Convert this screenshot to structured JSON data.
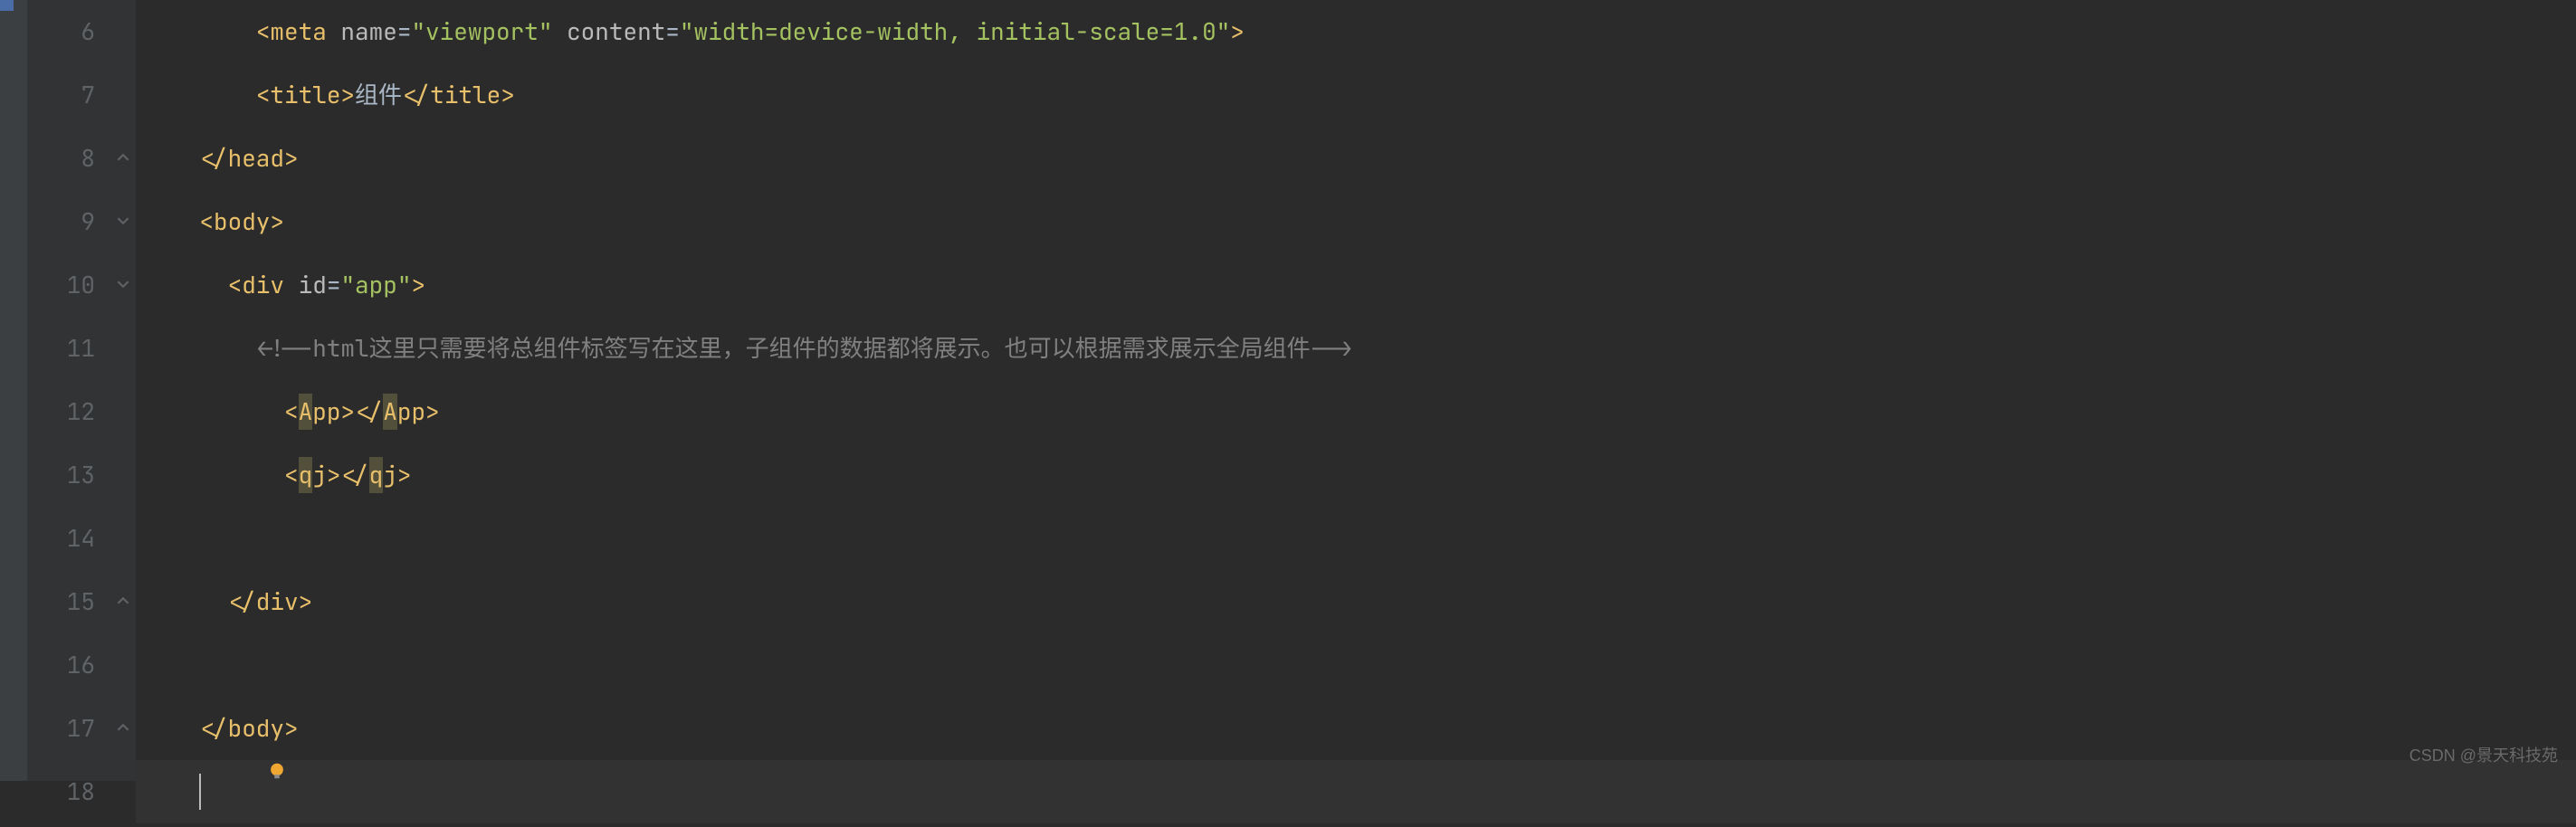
{
  "gutter": {
    "start": 6,
    "end": 18
  },
  "foldMarkers": [
    {
      "line": 8,
      "type": "up"
    },
    {
      "line": 9,
      "type": "down"
    },
    {
      "line": 10,
      "type": "down"
    },
    {
      "line": 15,
      "type": "up"
    },
    {
      "line": 17,
      "type": "up"
    }
  ],
  "bulb": {
    "line": 17
  },
  "code": {
    "line6": {
      "indent": "        ",
      "tagOpen": "<meta ",
      "attr1": "name",
      "eq1": "=",
      "val1": "\"viewport\"",
      "sp1": " ",
      "attr2": "content",
      "eq2": "=",
      "val2": "\"width=device-width, initial-scale=1.0\"",
      "tagClose": ">"
    },
    "line7": {
      "indent": "        ",
      "open": "<title>",
      "text": "组件",
      "close": "</title>"
    },
    "line8": {
      "indent": "    ",
      "close": "</head>"
    },
    "line9": {
      "indent": "    ",
      "open": "<body>"
    },
    "line10": {
      "indent": "      ",
      "openStart": "<div ",
      "attr": "id",
      "eq": "=",
      "val": "\"app\"",
      "openEnd": ">"
    },
    "line11": {
      "indent": "        ",
      "commentOpen": "<!--",
      "commentText": "html这里只需要将总组件标签写在这里，子组件的数据都将展示。也可以根据需求展示全局组件",
      "commentClose": "-->"
    },
    "line12": {
      "indent": "          ",
      "open1": "<",
      "hl1": "A",
      "rest1": "pp>",
      "open2": "</",
      "hl2": "A",
      "rest2": "pp>"
    },
    "line13": {
      "indent": "          ",
      "open1": "<",
      "hl1": "q",
      "rest1": "j>",
      "open2": "</",
      "hl2": "q",
      "rest2": "j>"
    },
    "line14": {
      "indent": ""
    },
    "line15": {
      "indent": "      ",
      "close": "</div>"
    },
    "line16": {
      "indent": ""
    },
    "line17": {
      "indent": "    ",
      "close": "</body>"
    },
    "line18": {
      "indent": "    "
    }
  },
  "watermark": "CSDN @景天科技苑"
}
